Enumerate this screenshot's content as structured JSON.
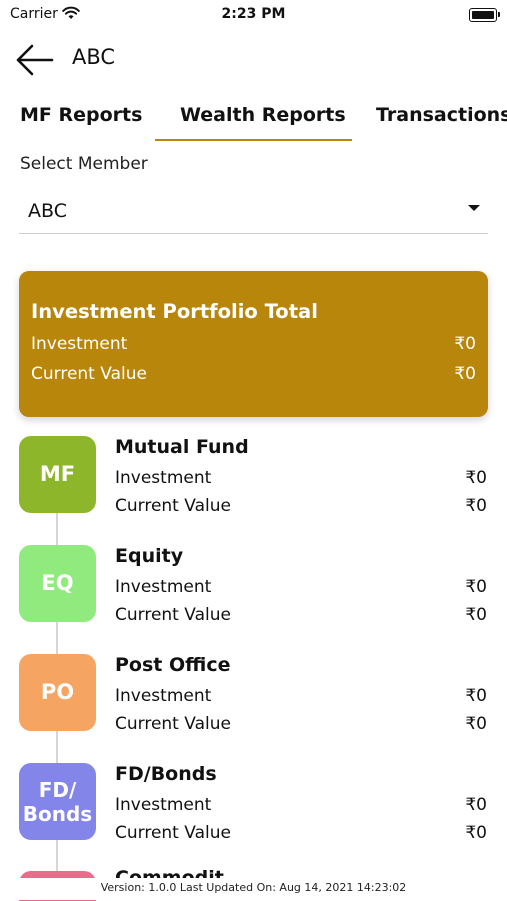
{
  "status_bar": {
    "carrier": "Carrier",
    "time": "2:23 PM"
  },
  "header": {
    "title": "ABC"
  },
  "tabs": [
    {
      "label": "MF Reports",
      "active": false
    },
    {
      "label": "Wealth Reports",
      "active": true
    },
    {
      "label": "Transactions",
      "active": false
    }
  ],
  "member": {
    "label": "Select Member",
    "value": "ABC"
  },
  "summary": {
    "title": "Investment Portfolio Total",
    "investment_label": "Investment",
    "investment_value": "₹0",
    "current_label": "Current Value",
    "current_value": "₹0"
  },
  "categories": [
    {
      "badge": "MF",
      "name": "Mutual Fund",
      "investment_label": "Investment",
      "investment_value": "₹0",
      "current_label": "Current Value",
      "current_value": "₹0",
      "color": "#8db62b"
    },
    {
      "badge": "EQ",
      "name": "Equity",
      "investment_label": "Investment",
      "investment_value": "₹0",
      "current_label": "Current Value",
      "current_value": "₹0",
      "color": "#90ea7e"
    },
    {
      "badge": "PO",
      "name": "Post Office",
      "investment_label": "Investment",
      "investment_value": "₹0",
      "current_label": "Current Value",
      "current_value": "₹0",
      "color": "#f5a462"
    },
    {
      "badge": "FD/ Bonds",
      "name": "FD/Bonds",
      "investment_label": "Investment",
      "investment_value": "₹0",
      "current_label": "Current Value",
      "current_value": "₹0",
      "color": "#8385e8"
    },
    {
      "badge": "",
      "name": "Commodit",
      "color": "#ea6c8b"
    }
  ],
  "footer": {
    "text": "Version: 1.0.0 Last Updated On: Aug 14, 2021 14:23:02"
  },
  "colors": {
    "accent": "#b8860b"
  }
}
